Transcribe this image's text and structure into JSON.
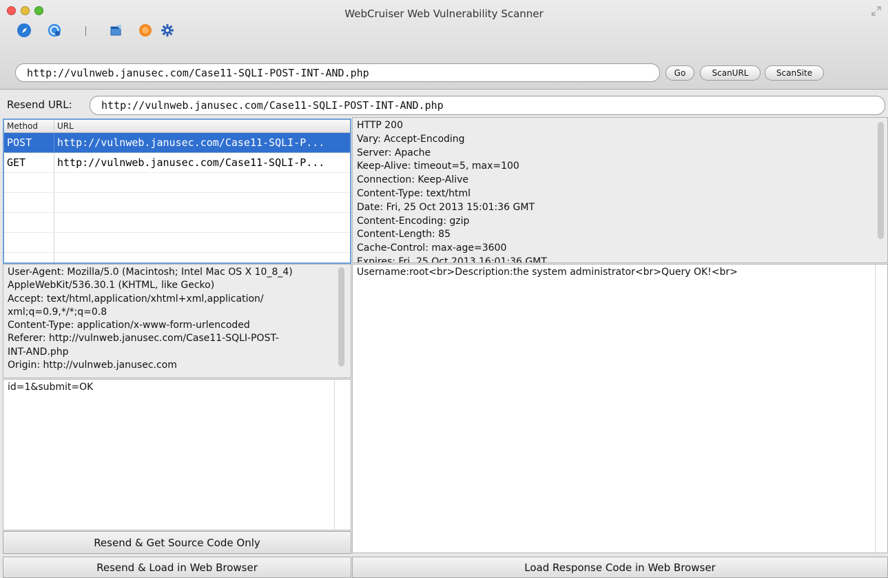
{
  "window": {
    "title": "WebCruiser Web Vulnerability Scanner"
  },
  "toolbar": {
    "icons": [
      "compass-icon",
      "refresh-globe-icon",
      "separator",
      "window-edit-icon",
      "record-icon",
      "gear-icon"
    ],
    "url_value": "http://vulnweb.janusec.com/Case11-SQLI-POST-INT-AND.php",
    "go_label": "Go",
    "scanurl_label": "ScanURL",
    "scansite_label": "ScanSite"
  },
  "resend": {
    "label": "Resend URL:",
    "url_value": "http://vulnweb.janusec.com/Case11-SQLI-POST-INT-AND.php"
  },
  "request_table": {
    "columns": [
      "Method",
      "URL"
    ],
    "rows": [
      {
        "method": "POST",
        "url": "http://vulnweb.janusec.com/Case11-SQLI-P..."
      },
      {
        "method": "GET",
        "url": "http://vulnweb.janusec.com/Case11-SQLI-P..."
      }
    ]
  },
  "request_headers": "User-Agent: Mozilla/5.0 (Macintosh; Intel Mac OS X 10_8_4)\nAppleWebKit/536.30.1 (KHTML, like Gecko)\nAccept: text/html,application/xhtml+xml,application/\nxml;q=0.9,*/*;q=0.8\nContent-Type: application/x-www-form-urlencoded\nReferer: http://vulnweb.janusec.com/Case11-SQLI-POST-\nINT-AND.php\nOrigin: http://vulnweb.janusec.com",
  "request_body": "id=1&submit=OK",
  "response_headers": "HTTP 200\nVary: Accept-Encoding\nServer: Apache\nKeep-Alive: timeout=5, max=100\nConnection: Keep-Alive\nContent-Type: text/html\nDate: Fri, 25 Oct 2013 15:01:36 GMT\nContent-Encoding: gzip\nContent-Length: 85\nCache-Control: max-age=3600\nExpires: Fri, 25 Oct 2013 16:01:36 GMT",
  "response_body": "Username:root<br>Description:the system administrator<br>Query OK!<br>",
  "buttons": {
    "resend_source": "Resend & Get Source Code Only",
    "resend_browser": "Resend & Load in Web Browser",
    "load_response": "Load Response Code in Web Browser"
  },
  "colors": {
    "selection": "#2f6fd0",
    "traffic_close": "#fc5b57",
    "traffic_min": "#e5bf3c",
    "traffic_max": "#57c038"
  }
}
